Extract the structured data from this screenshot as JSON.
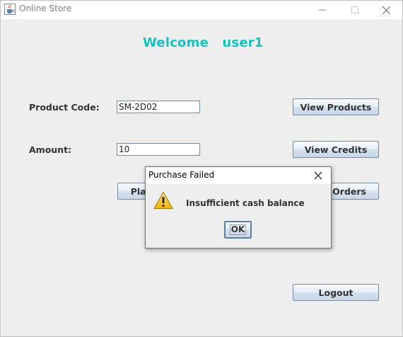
{
  "window": {
    "title": "Online Store",
    "icon": "java-cup-icon"
  },
  "header": {
    "welcome_text": "Welcome   user1",
    "color": "#14c3c3"
  },
  "form": {
    "product_code_label": "Product Code:",
    "product_code_value": "SM-2D02",
    "amount_label": "Amount:",
    "amount_value": "10"
  },
  "buttons": {
    "view_products": "View Products",
    "view_credits": "View Credits",
    "place_order": "Place Order",
    "view_orders": "View Orders",
    "logout": "Logout"
  },
  "dialog": {
    "title": "Purchase Failed",
    "message": "Insufficient cash balance",
    "ok_label": "OK",
    "icon": "warning-icon"
  }
}
